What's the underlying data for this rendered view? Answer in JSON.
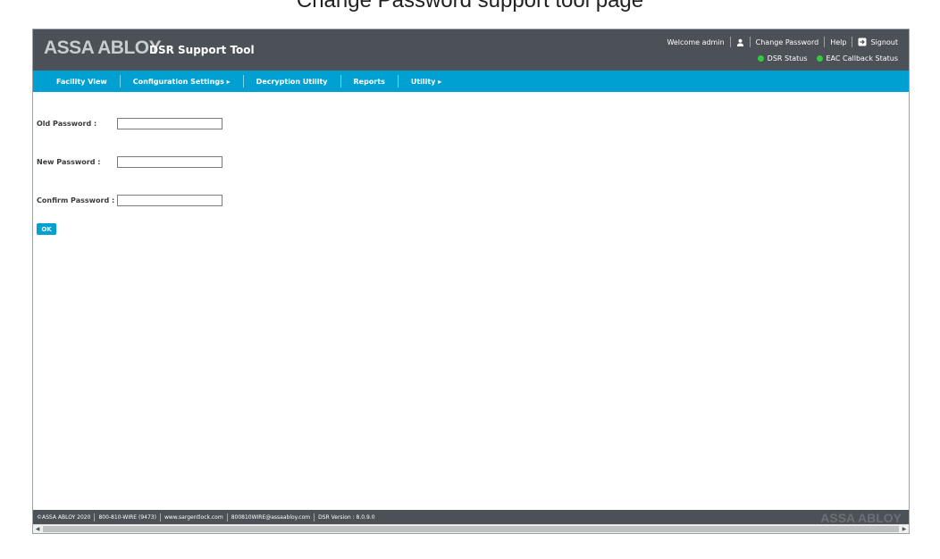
{
  "caption": "Change Password support tool page",
  "header": {
    "logo": "ASSA ABLOY",
    "app_title": "DSR Support Tool",
    "welcome": "Welcome admin",
    "change_password": "Change Password",
    "help": "Help",
    "signout": "Signout",
    "status": [
      {
        "label": "DSR Status",
        "color": "#2ecc40"
      },
      {
        "label": "EAC Callback Status",
        "color": "#2ecc40"
      }
    ]
  },
  "nav": {
    "items": [
      {
        "label": "Facility View"
      },
      {
        "label": "Configuration Settings ▸"
      },
      {
        "label": "Decryption Utility"
      },
      {
        "label": "Reports"
      },
      {
        "label": "Utility ▸"
      }
    ]
  },
  "form": {
    "old_password_label": "Old Password :",
    "old_password_value": "",
    "new_password_label": "New Password :",
    "new_password_value": "",
    "confirm_password_label": "Confirm Password :",
    "confirm_password_value": "",
    "ok_label": "OK"
  },
  "footer": {
    "copyright": "©ASSA ABLOY 2020",
    "phone": "800-810-WIRE (9473)",
    "website": "www.sargentlock.com",
    "email": "800810WIRE@assaabloy.com",
    "version": "DSR Version : 8.0.9.0",
    "logo": "ASSA ABLOY"
  },
  "colors": {
    "header_bg": "#4b5156",
    "nav_bg": "#00a0d2",
    "accent": "#00a0d2"
  }
}
